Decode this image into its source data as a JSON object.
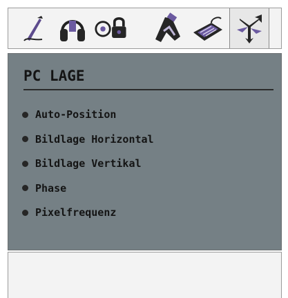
{
  "toolbar": {
    "icons": [
      "pen-icon",
      "headphones-icon",
      "lock-icon",
      "hand-tool-icon",
      "keyboard-icon",
      "directional-arrows-icon"
    ],
    "active": "directional-arrows-icon"
  },
  "panel": {
    "title": "PC LAGE",
    "items": [
      {
        "label": "Auto-Position"
      },
      {
        "label": "Bildlage Horizontal"
      },
      {
        "label": "Bildlage Vertikal"
      },
      {
        "label": "Phase"
      },
      {
        "label": "Pixelfrequenz"
      }
    ]
  },
  "colors": {
    "panel_bg": "#758085",
    "toolbar_bg": "#f3f3f3",
    "text": "#141414"
  }
}
